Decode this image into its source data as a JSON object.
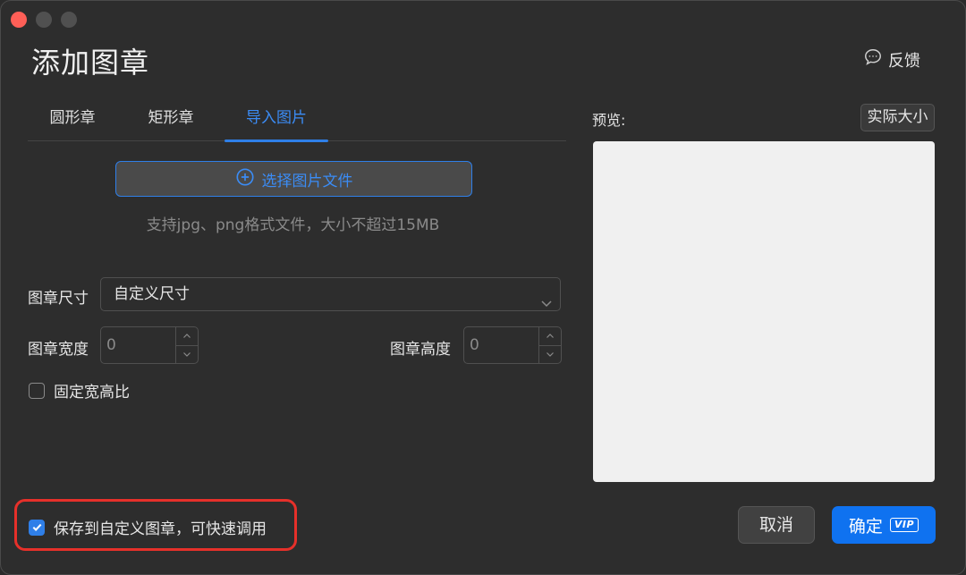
{
  "window": {
    "title": "添加图章"
  },
  "header": {
    "feedback_label": "反馈"
  },
  "tabs": [
    {
      "label": "圆形章"
    },
    {
      "label": "矩形章"
    },
    {
      "label": "导入图片",
      "active": true
    }
  ],
  "upload": {
    "button_label": "选择图片文件",
    "hint": "支持jpg、png格式文件，大小不超过15MB"
  },
  "form": {
    "size_label": "图章尺寸",
    "size_value": "自定义尺寸",
    "width_label": "图章宽度",
    "width_value": "0",
    "height_label": "图章高度",
    "height_value": "0",
    "fixed_ratio_label": "固定宽高比",
    "fixed_ratio_checked": false
  },
  "save_custom": {
    "label": "保存到自定义图章，可快速调用",
    "checked": true
  },
  "preview": {
    "label": "预览:",
    "actual_size_label": "实际大小"
  },
  "footer": {
    "cancel_label": "取消",
    "ok_label": "确定",
    "vip_badge": "VIP"
  },
  "colors": {
    "accent": "#2f7fe8",
    "highlight": "#e6302a",
    "background": "#2d2d2d"
  }
}
